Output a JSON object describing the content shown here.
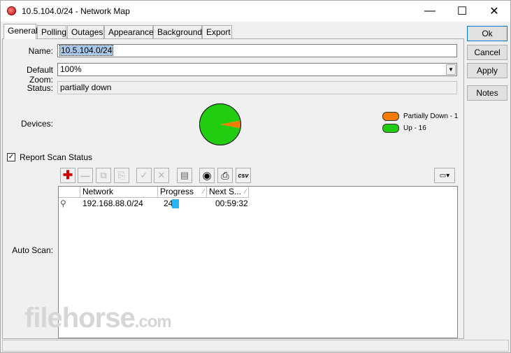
{
  "window": {
    "title": "10.5.104.0/24 - Network Map"
  },
  "tabs": [
    "General",
    "Polling",
    "Outages",
    "Appearance",
    "Background",
    "Export"
  ],
  "general": {
    "name_label": "Name:",
    "name_value": "10.5.104.0/24",
    "zoom_label": "Default Zoom:",
    "zoom_value": "100%",
    "status_label": "Status:",
    "status_value": "partially down",
    "devices_label": "Devices:",
    "legend": [
      {
        "label": "Partially Down - 1",
        "color": "#f57c00",
        "count": 1
      },
      {
        "label": "Up - 16",
        "color": "#22cc11",
        "count": 16
      }
    ],
    "report_scan_label": "Report Scan Status",
    "report_scan_checked": true,
    "auto_scan_label": "Auto Scan:"
  },
  "buttons": {
    "ok": "Ok",
    "cancel": "Cancel",
    "apply": "Apply",
    "notes": "Notes"
  },
  "toolbar": {
    "icons": [
      "add-icon",
      "remove-icon",
      "copy-icon",
      "paste-icon",
      "check-icon",
      "cross-icon",
      "comment-icon",
      "find-icon",
      "print-icon",
      "csv-icon"
    ],
    "csv_label": "csv"
  },
  "scan_table": {
    "columns": [
      "Network",
      "Progress",
      "Next S..."
    ],
    "rows": [
      {
        "network": "192.168.88.0/24",
        "progress": "24",
        "next": "00:59:32"
      }
    ]
  },
  "watermark": {
    "main": "filehorse",
    "suffix": ".com"
  },
  "colors": {
    "selection": "#aac8ea",
    "progress": "#2ab3f1",
    "up": "#22cc11",
    "partially_down": "#f57c00"
  }
}
